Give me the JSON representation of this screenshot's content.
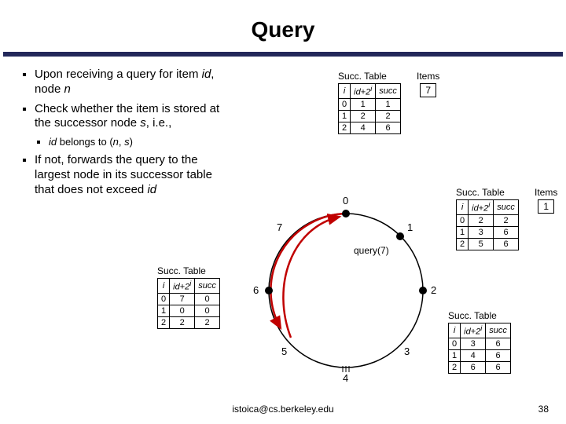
{
  "title": "Query",
  "bullets": [
    "Upon receiving a query for item <span class='em'>id</span>, node <span class='em'>n</span>",
    "Check whether the item is stored at the successor node <span class='em'>s</span>, i.e., ",
    "If not, forwards the query to the largest node in its successor table that does not exceed <span class='em'>id</span>"
  ],
  "sub_bullet": "<span class='em'>id</span> belongs to (<span class='em'>n</span>, <span class='em'>s</span>)",
  "ring_labels": [
    "0",
    "1",
    "2",
    "3",
    "4",
    "5",
    "6",
    "7"
  ],
  "query_label": "query(7)",
  "footer_email": "istoica@cs.berkeley.edu",
  "page_number": "38",
  "tables": {
    "node0": {
      "title": "Succ. Table",
      "rows": [
        [
          "0",
          "1",
          "1"
        ],
        [
          "1",
          "2",
          "2"
        ],
        [
          "2",
          "4",
          "6"
        ]
      ],
      "items": "7"
    },
    "node1": {
      "title": "Succ. Table",
      "rows": [
        [
          "0",
          "2",
          "2"
        ],
        [
          "1",
          "3",
          "6"
        ],
        [
          "2",
          "5",
          "6"
        ]
      ],
      "items": "1"
    },
    "node2": {
      "title": "Succ. Table",
      "rows": [
        [
          "0",
          "3",
          "6"
        ],
        [
          "1",
          "4",
          "6"
        ],
        [
          "2",
          "6",
          "6"
        ]
      ]
    },
    "node6": {
      "title": "Succ. Table",
      "rows": [
        [
          "0",
          "7",
          "0"
        ],
        [
          "1",
          "0",
          "0"
        ],
        [
          "2",
          "2",
          "2"
        ]
      ]
    }
  },
  "table_headers": [
    "i",
    "id+2",
    "succ"
  ],
  "table_header_sup": "i",
  "items_label": "Items"
}
